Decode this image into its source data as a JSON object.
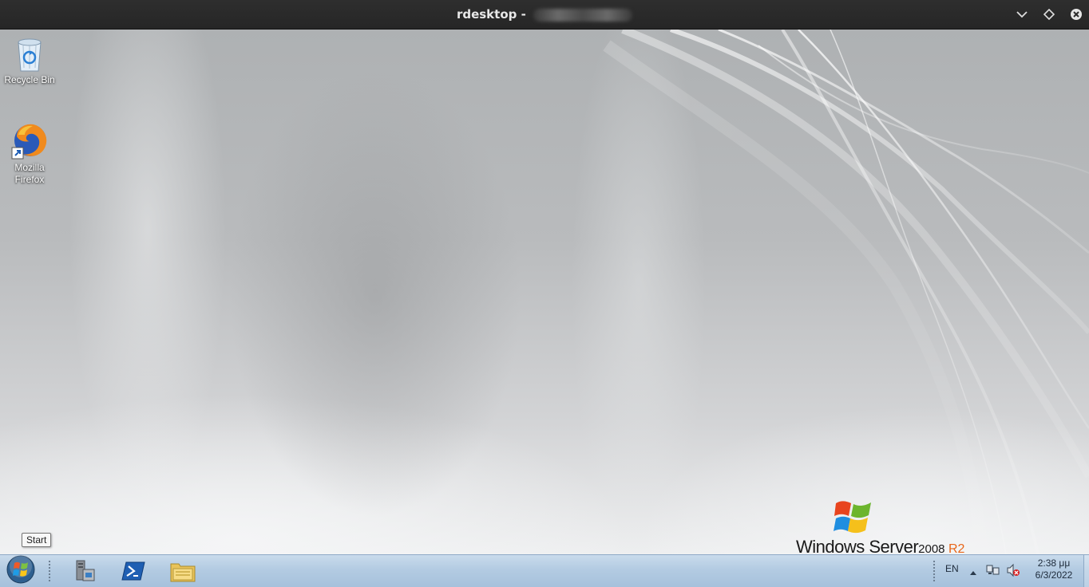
{
  "window": {
    "title": "rdesktop -",
    "title_host_redacted": true,
    "controls": [
      "minimize-chevron-icon",
      "maximize-diamond-icon",
      "close-icon"
    ]
  },
  "desktop": {
    "icons": [
      {
        "label": "Recycle Bin",
        "icon": "recycle-bin-icon"
      },
      {
        "label": "Mozilla Firefox",
        "icon": "firefox-icon"
      }
    ],
    "tooltip": "Start",
    "branding": {
      "main": "Windows Server",
      "version": "2008",
      "edition": "R2",
      "logo": "windows-flag-logo"
    }
  },
  "taskbar": {
    "start_icon": "windows-start-orb-icon",
    "pinned": [
      "server-manager-icon",
      "powershell-icon",
      "windows-explorer-icon"
    ],
    "tray": {
      "language": "EN",
      "icons": [
        "show-hidden-icons-arrow",
        "network-icon",
        "volume-muted-icon"
      ],
      "time": "2:38 μμ",
      "date": "6/3/2022"
    }
  },
  "colors": {
    "titlebar": "#2b2b2b",
    "taskbar": "#b3cbe2",
    "brand_r2": "#e8661a"
  }
}
